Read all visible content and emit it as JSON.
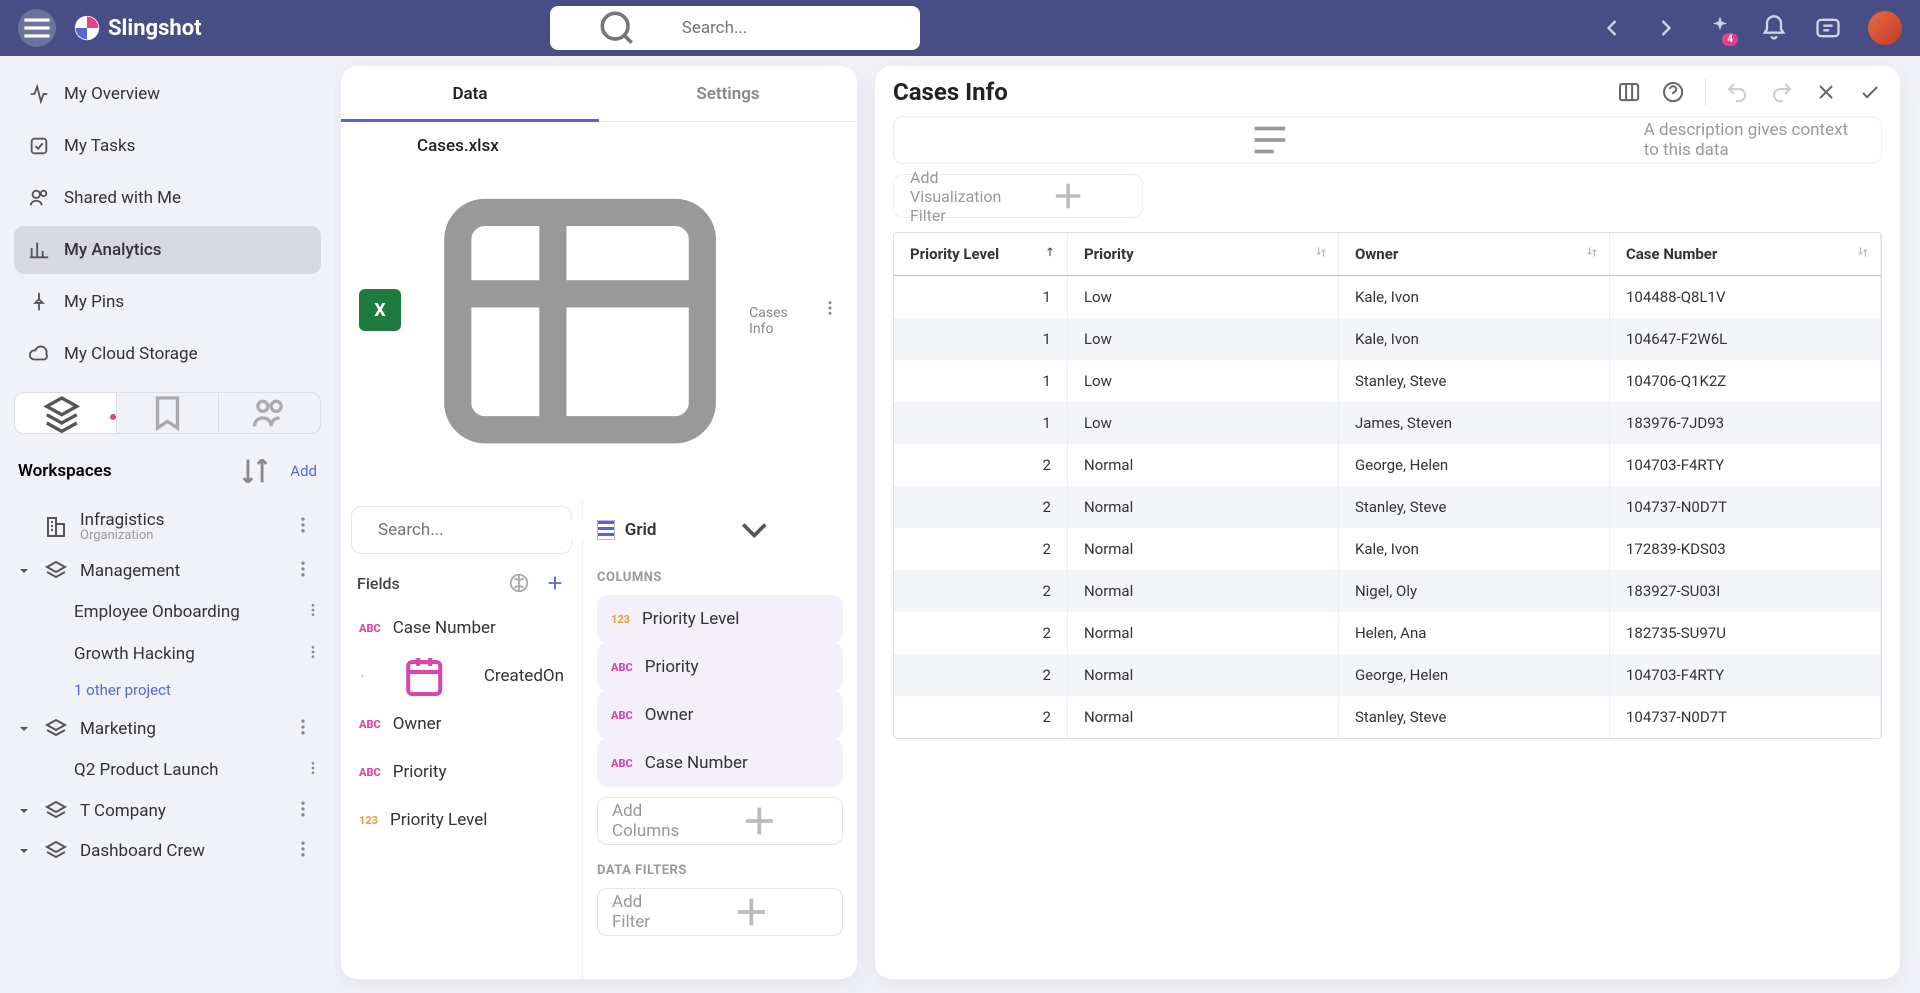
{
  "topbar": {
    "brand": "Slingshot",
    "search_placeholder": "Search...",
    "badge_count": "4"
  },
  "sidebar": {
    "items": [
      {
        "label": "My Overview"
      },
      {
        "label": "My Tasks"
      },
      {
        "label": "Shared with Me"
      },
      {
        "label": "My Analytics"
      },
      {
        "label": "My Pins"
      },
      {
        "label": "My Cloud Storage"
      }
    ],
    "workspaces_heading": "Workspaces",
    "add_label": "Add",
    "workspaces": [
      {
        "name": "Infragistics",
        "sub": "Organization",
        "children": []
      },
      {
        "name": "Management",
        "children": [
          "Employee Onboarding",
          "Growth Hacking"
        ],
        "more": "1 other project"
      },
      {
        "name": "Marketing",
        "children": [
          "Q2 Product Launch"
        ]
      },
      {
        "name": "T Company",
        "children": []
      },
      {
        "name": "Dashboard Crew",
        "children": []
      }
    ]
  },
  "leftPanel": {
    "tabs": {
      "data": "Data",
      "settings": "Settings"
    },
    "file": {
      "name": "Cases.xlsx",
      "sheet": "Cases Info"
    },
    "search_placeholder": "Search...",
    "fields_heading": "Fields",
    "viz_label": "Grid",
    "fields": [
      {
        "type": "abc",
        "label": "Case Number"
      },
      {
        "type": "date",
        "label": "CreatedOn",
        "expandable": true
      },
      {
        "type": "abc",
        "label": "Owner"
      },
      {
        "type": "abc",
        "label": "Priority"
      },
      {
        "type": "123",
        "label": "Priority Level"
      }
    ],
    "columns_heading": "COLUMNS",
    "columns": [
      {
        "type": "123",
        "label": "Priority Level"
      },
      {
        "type": "abc",
        "label": "Priority"
      },
      {
        "type": "abc",
        "label": "Owner"
      },
      {
        "type": "abc",
        "label": "Case Number"
      }
    ],
    "add_columns": "Add Columns",
    "filters_heading": "DATA FILTERS",
    "add_filter": "Add Filter"
  },
  "rightPanel": {
    "title": "Cases Info",
    "desc_placeholder": "A description gives context to this data",
    "filter_label": "Add Visualization Filter",
    "headers": [
      "Priority Level",
      "Priority",
      "Owner",
      "Case Number"
    ],
    "rows": [
      [
        "1",
        "Low",
        "Kale, Ivon",
        "104488-Q8L1V"
      ],
      [
        "1",
        "Low",
        "Kale, Ivon",
        "104647-F2W6L"
      ],
      [
        "1",
        "Low",
        "Stanley, Steve",
        "104706-Q1K2Z"
      ],
      [
        "1",
        "Low",
        "James, Steven",
        "183976-7JD93"
      ],
      [
        "2",
        "Normal",
        "George, Helen",
        "104703-F4RTY"
      ],
      [
        "2",
        "Normal",
        "Stanley, Steve",
        "104737-N0D7T"
      ],
      [
        "2",
        "Normal",
        "Kale, Ivon",
        "172839-KDS03"
      ],
      [
        "2",
        "Normal",
        "Nigel, Oly",
        "183927-SU03I"
      ],
      [
        "2",
        "Normal",
        "Helen, Ana",
        "182735-SU97U"
      ],
      [
        "2",
        "Normal",
        "George, Helen",
        "104703-F4RTY"
      ],
      [
        "2",
        "Normal",
        "Stanley, Steve",
        "104737-N0D7T"
      ]
    ]
  }
}
